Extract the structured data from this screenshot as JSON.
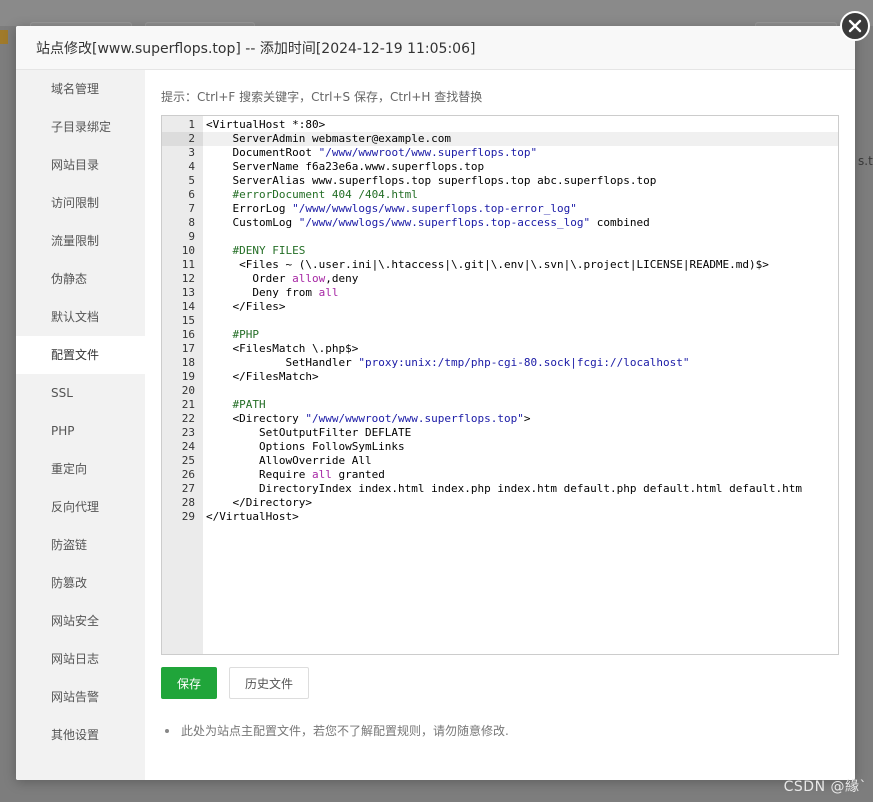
{
  "dialog": {
    "title": "站点修改[www.superflops.top] -- 添加时间[2024-12-19 11:05:06]"
  },
  "sidebar": {
    "items": [
      {
        "label": "域名管理"
      },
      {
        "label": "子目录绑定"
      },
      {
        "label": "网站目录"
      },
      {
        "label": "访问限制"
      },
      {
        "label": "流量限制"
      },
      {
        "label": "伪静态"
      },
      {
        "label": "默认文档"
      },
      {
        "label": "配置文件",
        "active": true
      },
      {
        "label": "SSL"
      },
      {
        "label": "PHP"
      },
      {
        "label": "重定向"
      },
      {
        "label": "反向代理"
      },
      {
        "label": "防盗链"
      },
      {
        "label": "防篡改"
      },
      {
        "label": "网站安全"
      },
      {
        "label": "网站日志"
      },
      {
        "label": "网站告警"
      },
      {
        "label": "其他设置"
      }
    ]
  },
  "main": {
    "tips": "提示：Ctrl+F 搜索关键字，Ctrl+S 保存，Ctrl+H 查找替换",
    "save_label": "保存",
    "history_label": "历史文件",
    "note": "此处为站点主配置文件，若您不了解配置规则，请勿随意修改."
  },
  "editor": {
    "active_line": 2,
    "lines": [
      "<VirtualHost *:80>",
      "    ServerAdmin webmaster@example.com",
      "    DocumentRoot \"/www/wwwroot/www.superflops.top\"",
      "    ServerName f6a23e6a.www.superflops.top",
      "    ServerAlias www.superflops.top superflops.top abc.superflops.top",
      "    #errorDocument 404 /404.html",
      "    ErrorLog \"/www/wwwlogs/www.superflops.top-error_log\"",
      "    CustomLog \"/www/wwwlogs/www.superflops.top-access_log\" combined",
      "",
      "    #DENY FILES",
      "     <Files ~ (\\.user.ini|\\.htaccess|\\.git|\\.env|\\.svn|\\.project|LICENSE|README.md)$>",
      "       Order allow,deny",
      "       Deny from all",
      "    </Files>",
      "",
      "    #PHP",
      "    <FilesMatch \\.php$>",
      "            SetHandler \"proxy:unix:/tmp/php-cgi-80.sock|fcgi://localhost\"",
      "    </FilesMatch>",
      "",
      "    #PATH",
      "    <Directory \"/www/wwwroot/www.superflops.top\">",
      "        SetOutputFilter DEFLATE",
      "        Options FollowSymLinks",
      "        AllowOverride All",
      "        Require all granted",
      "        DirectoryIndex index.html index.php index.htm default.php default.html default.htm",
      "    </Directory>",
      "</VirtualHost>"
    ]
  },
  "background": {
    "side_text": "s.to",
    "watermark": "CSDN @緣`"
  },
  "colors": {
    "accent": "#20a53a",
    "string": "#1a1aa6",
    "comment": "#236e25",
    "keyword": "#a626a4"
  }
}
